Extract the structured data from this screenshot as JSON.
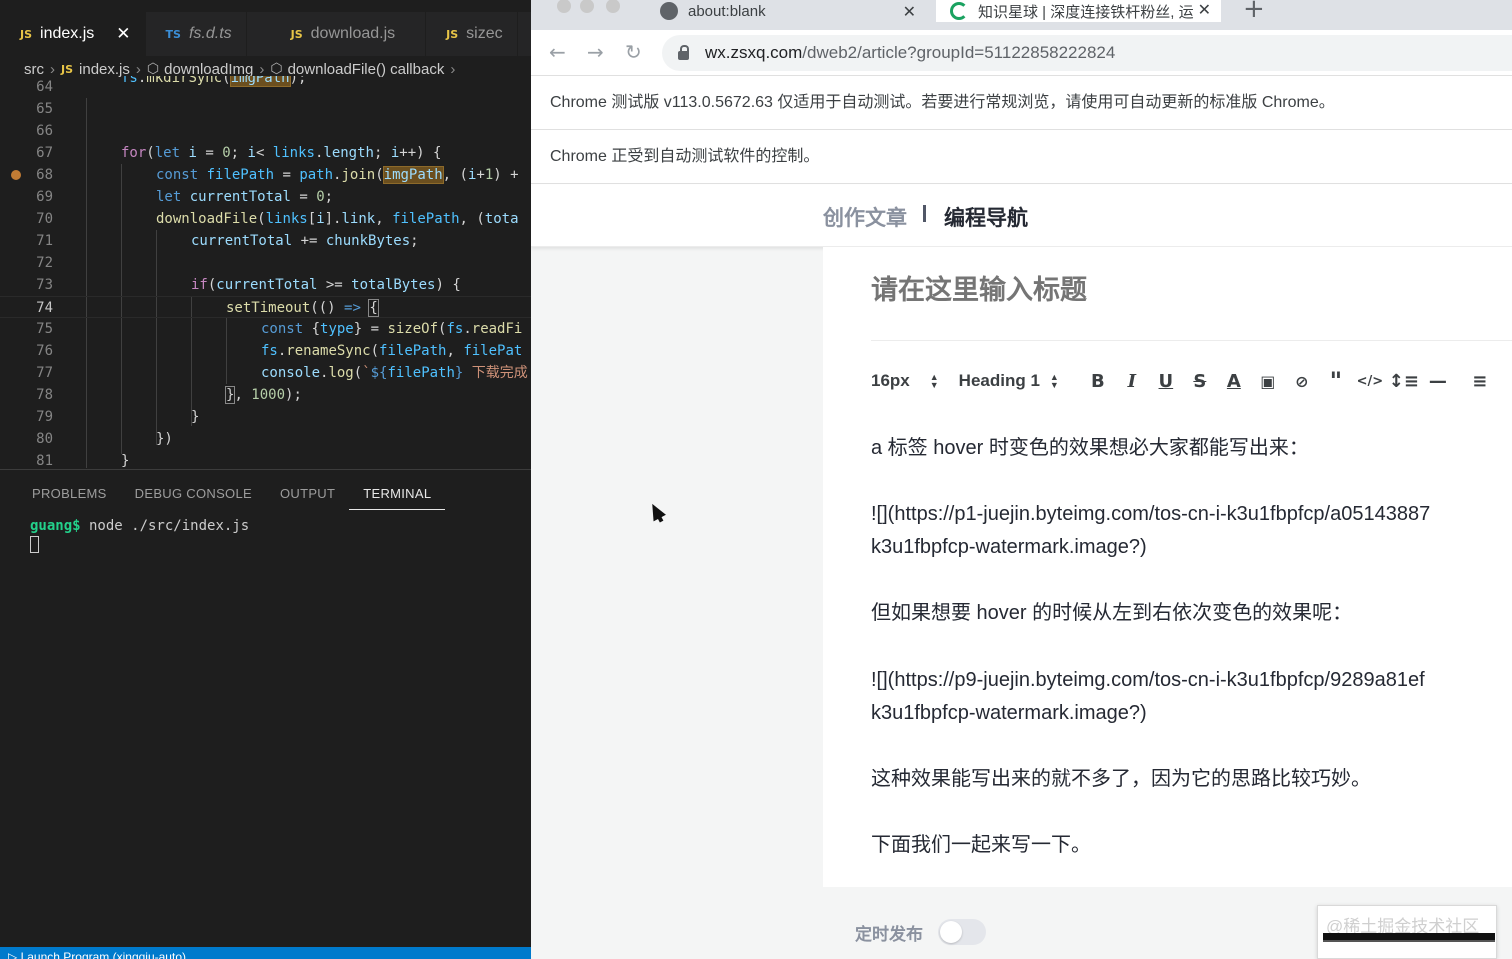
{
  "vscode": {
    "tabs": [
      {
        "lang": "JS",
        "name": "index.js",
        "active": true
      },
      {
        "lang": "TS",
        "name": "fs.d.ts",
        "active": false
      },
      {
        "lang": "JS",
        "name": "download.js",
        "active": false
      },
      {
        "lang": "JS",
        "name": "sizec",
        "active": false
      }
    ],
    "breadcrumb": [
      "src",
      "index.js",
      "downloadImg",
      "downloadFile() callback"
    ],
    "breadcrumb_icon": "JS",
    "line_numbers": [
      "64",
      "65",
      "66",
      "67",
      "68",
      "69",
      "70",
      "71",
      "72",
      "73",
      "74",
      "75",
      "76",
      "77",
      "78",
      "79",
      "80",
      "81"
    ],
    "current_line": "74",
    "breakpoint_line": "68",
    "panel_tabs": [
      "PROBLEMS",
      "DEBUG CONSOLE",
      "OUTPUT",
      "TERMINAL"
    ],
    "active_panel_tab": "TERMINAL",
    "terminal": {
      "prompt": "guang$",
      "command": " node ./src/index.js"
    },
    "status": "Launch Program (xingqiu-auto)"
  },
  "chrome": {
    "tabs": [
      {
        "title": "about:blank",
        "icon": "globe-icon"
      },
      {
        "title": "知识星球 | 深度连接铁杆粉丝, 运",
        "icon": "loading-spinner-icon"
      }
    ],
    "url_host": "wx.zsxq.com",
    "url_path": "/dweb2/article?groupId=51122858222824",
    "infobar1": "Chrome 测试版 v113.0.5672.63 仅适用于自动测试。若要进行常规浏览，请使用可自动更新的标准版 Chrome。",
    "infobar2": "Chrome 正受到自动测试软件的控制。"
  },
  "article": {
    "header_left": "创作文章",
    "header_right": "编程导航",
    "title_placeholder": "请在这里输入标题",
    "font_size": "16px",
    "heading": "Heading 1",
    "paragraphs": [
      "a 标签 hover 时变色的效果想必大家都能写出来：",
      "![](https://p1-juejin.byteimg.com/tos-cn-i-k3u1fbpfcp/a05143887",
      "k3u1fbpfcp-watermark.image?)",
      "但如果想要 hover 的时候从左到右依次变色的效果呢：",
      "![](https://p9-juejin.byteimg.com/tos-cn-i-k3u1fbpfcp/9289a81ef",
      "k3u1fbpfcp-watermark.image?)",
      "这种效果能写出来的就不多了，因为它的思路比较巧妙。",
      "下面我们一起来写一下。"
    ],
    "schedule_label": "定时发布",
    "schedule_enabled": false,
    "watermark": "@稀土掘金技术社区"
  }
}
